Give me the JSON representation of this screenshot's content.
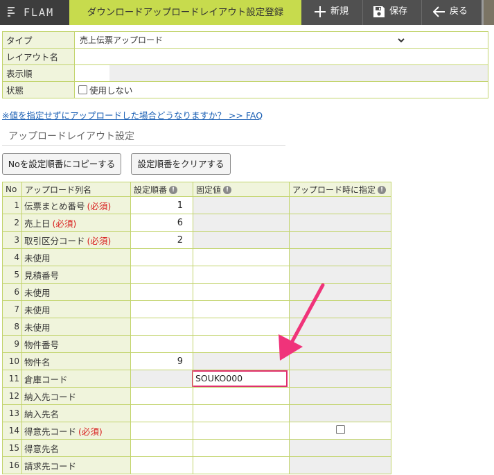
{
  "header": {
    "brand": "FLAM",
    "page_title": "ダウンロードアップロードレイアウト設定登録",
    "buttons": {
      "new": "新規",
      "save": "保存",
      "back": "戻る"
    },
    "icons": {
      "new": "plus-icon",
      "save": "floppy-disk-icon",
      "back": "arrow-left-icon"
    }
  },
  "form": {
    "type_label": "タイプ",
    "type_value": "売上伝票アップロード",
    "layout_name_label": "レイアウト名",
    "layout_name_value": "",
    "display_order_label": "表示順",
    "display_order_value": "",
    "status_label": "状態",
    "status_checkbox_label": "使用しない"
  },
  "faq_link": "※値を指定せずにアップロードした場合どうなりますか？ >> FAQ",
  "section_title": "アップロードレイアウト設定",
  "actions": {
    "copy_no": "Noを設定順番にコピーする",
    "clear_order": "設定順番をクリアする"
  },
  "grid": {
    "headers": {
      "no": "No",
      "column": "アップロード列名",
      "order": "設定順番",
      "fixed": "固定値",
      "specify": "アップロード時に指定"
    },
    "info_glyph": "!",
    "required_label": "(必須)",
    "rows": [
      {
        "no": "1",
        "name": "伝票まとめ番号",
        "required": true,
        "order": "1"
      },
      {
        "no": "2",
        "name": "売上日",
        "required": true,
        "order": "6"
      },
      {
        "no": "3",
        "name": "取引区分コード",
        "required": true,
        "order": "2"
      },
      {
        "no": "4",
        "name": "未使用",
        "required": false,
        "order": ""
      },
      {
        "no": "5",
        "name": "見積番号",
        "required": false,
        "order": ""
      },
      {
        "no": "6",
        "name": "未使用",
        "required": false,
        "order": ""
      },
      {
        "no": "7",
        "name": "未使用",
        "required": false,
        "order": ""
      },
      {
        "no": "8",
        "name": "未使用",
        "required": false,
        "order": ""
      },
      {
        "no": "9",
        "name": "物件番号",
        "required": false,
        "order": ""
      },
      {
        "no": "10",
        "name": "物件名",
        "required": false,
        "order": "9"
      },
      {
        "no": "11",
        "name": "倉庫コード",
        "required": false,
        "order": "",
        "fixed": "SOUKO000"
      },
      {
        "no": "12",
        "name": "納入先コード",
        "required": false,
        "order": ""
      },
      {
        "no": "13",
        "name": "納入先名",
        "required": false,
        "order": ""
      },
      {
        "no": "14",
        "name": "得意先コード",
        "required": true,
        "order": "",
        "specify_checkbox": true
      },
      {
        "no": "15",
        "name": "得意先名",
        "required": false,
        "order": ""
      },
      {
        "no": "16",
        "name": "請求先コード",
        "required": false,
        "order": ""
      }
    ]
  },
  "annotation": {
    "arrow_color": "#f0337a",
    "highlight_color": "#e0306e"
  },
  "colors": {
    "accent": "#c7db4d",
    "topbar": "#505050",
    "border": "#c2d46c",
    "label_bg": "#f0f4dc"
  }
}
